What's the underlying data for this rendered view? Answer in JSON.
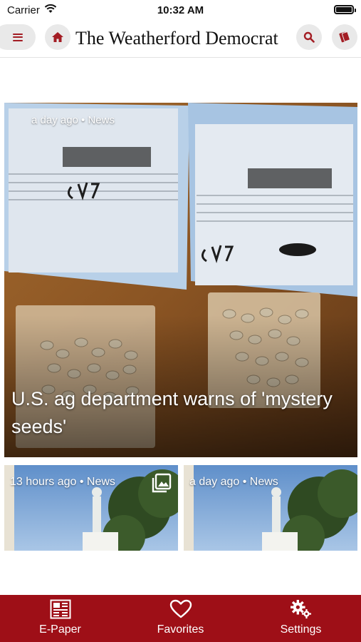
{
  "status_bar": {
    "carrier": "Carrier",
    "time": "10:32 AM"
  },
  "header": {
    "brand": "The Weatherford Democrat"
  },
  "hero": {
    "meta": "a day ago • News",
    "title": "U.S. ag department warns of 'mystery seeds'"
  },
  "cards": [
    {
      "meta": "13 hours ago • News"
    },
    {
      "meta": "a day ago • News"
    }
  ],
  "tabs": [
    {
      "label": "E-Paper",
      "icon": "newspaper-icon"
    },
    {
      "label": "Favorites",
      "icon": "heart-icon"
    },
    {
      "label": "Settings",
      "icon": "gears-icon"
    }
  ],
  "colors": {
    "brand_red": "#9e0f17",
    "icon_red": "#a31d24",
    "button_gray": "#e9e9e9"
  }
}
